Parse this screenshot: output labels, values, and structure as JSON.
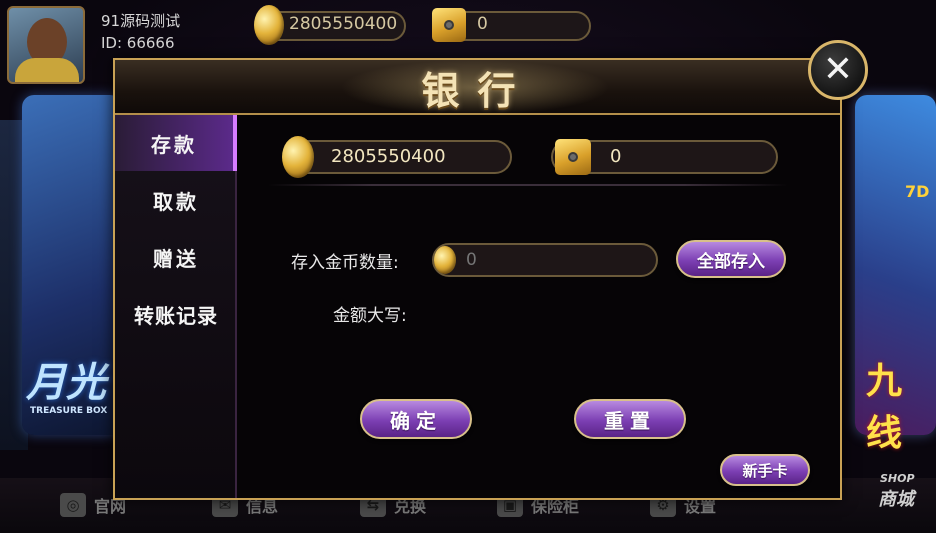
{
  "user": {
    "name": "91源码测试",
    "id": "ID: 66666"
  },
  "top_balances": {
    "coins": "2805550400",
    "safe": "0"
  },
  "background": {
    "left_card_title": "月光",
    "left_card_sub": "TREASURE BOX",
    "right_card_title": "九线",
    "right_card_badge": "7D"
  },
  "bottom_nav": {
    "items": [
      {
        "label": "官网",
        "icon": "globe-icon"
      },
      {
        "label": "信息",
        "icon": "mail-icon"
      },
      {
        "label": "兑换",
        "icon": "exchange-icon"
      },
      {
        "label": "保险柜",
        "icon": "safe-icon"
      },
      {
        "label": "设置",
        "icon": "gear-icon"
      }
    ],
    "shop_en": "SHOP",
    "shop_cn": "商城"
  },
  "dialog": {
    "title": "银行",
    "close_icon": "close-icon",
    "sidebar": [
      {
        "label": "存款",
        "active": true
      },
      {
        "label": "取款",
        "active": false
      },
      {
        "label": "赠送",
        "active": false
      },
      {
        "label": "转账记录",
        "active": false
      }
    ],
    "balances": {
      "coins": "2805550400",
      "safe": "0"
    },
    "form": {
      "amount_label": "存入金币数量:",
      "amount_placeholder": "0",
      "deposit_all_label": "全部存入",
      "uppercase_label": "金额大写:"
    },
    "buttons": {
      "confirm": "确定",
      "reset": "重置",
      "newbie_card": "新手卡"
    }
  },
  "colors": {
    "gold_border": "#c9a255",
    "purple_button": "#7c3fb3",
    "active_tab": "#5b2a8a"
  }
}
